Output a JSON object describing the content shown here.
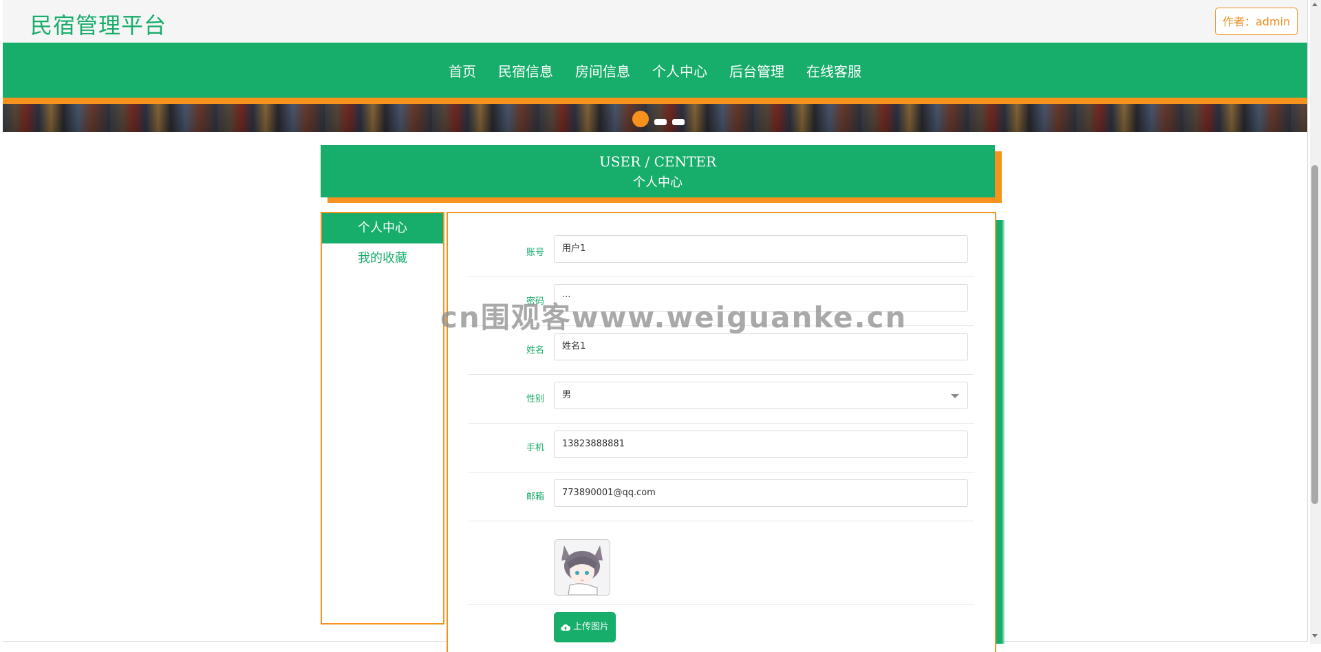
{
  "header": {
    "site_title": "民宿管理平台",
    "author_label": "作者：admin"
  },
  "nav": {
    "items": [
      {
        "label": "首页"
      },
      {
        "label": "民宿信息"
      },
      {
        "label": "房间信息"
      },
      {
        "label": "个人中心"
      },
      {
        "label": "后台管理"
      },
      {
        "label": "在线客服"
      }
    ]
  },
  "banner": {
    "active_slide": 1,
    "slide_count": 3
  },
  "section": {
    "title_en": "USER / CENTER",
    "title_cn": "个人中心"
  },
  "sidebar": {
    "items": [
      {
        "label": "个人中心",
        "active": true
      },
      {
        "label": "我的收藏",
        "active": false
      }
    ]
  },
  "form": {
    "fields": [
      {
        "label": "账号",
        "value": "用户1"
      },
      {
        "label": "密码",
        "value": "···"
      },
      {
        "label": "姓名",
        "value": "姓名1"
      },
      {
        "label": "性别",
        "value": "男"
      },
      {
        "label": "手机",
        "value": "13823888881"
      },
      {
        "label": "邮箱",
        "value": "773890001@qq.com"
      }
    ],
    "upload_label": "上传图片"
  },
  "watermark": "cn围观客www.weiguanke.cn",
  "colors": {
    "brand_green": "#17ad6a",
    "accent_orange": "#f7921e"
  },
  "icons": {
    "upload": "cloud-upload-icon",
    "select": "chevron-down-icon"
  }
}
